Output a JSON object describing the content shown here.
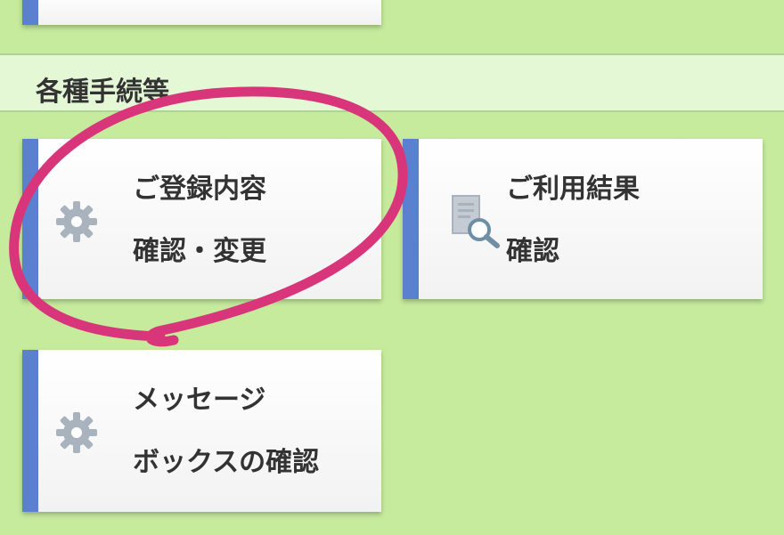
{
  "section": {
    "title": "各種手続等"
  },
  "cards": {
    "registration": {
      "line1": "ご登録内容",
      "line2": "確認・変更",
      "icon": "gear-icon"
    },
    "usage": {
      "line1": "ご利用結果",
      "line2": "確認",
      "icon": "document-search-icon"
    },
    "message": {
      "line1": "メッセージ",
      "line2": "ボックスの確認",
      "icon": "gear-icon"
    }
  },
  "colors": {
    "background": "#c6eb9d",
    "header_band": "#e4f8d6",
    "card_accent": "#5b80cf",
    "icon": "#a9b3bd",
    "annotation": "#d8357a"
  }
}
